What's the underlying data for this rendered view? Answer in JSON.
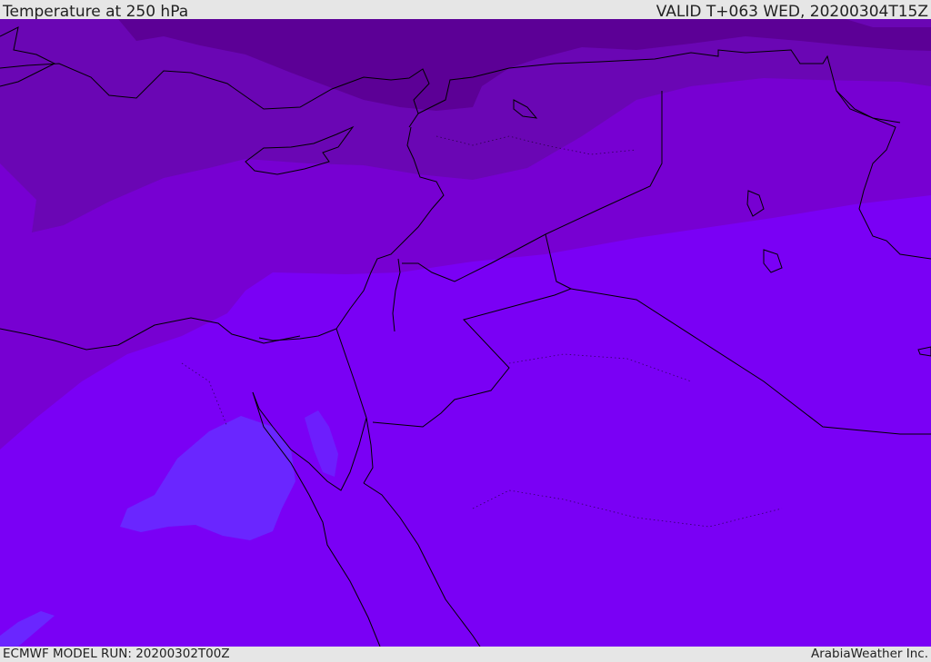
{
  "header": {
    "title": "Temperature at 250 hPa",
    "valid": "VALID T+063 WED, 20200304T15Z"
  },
  "footer": {
    "model_run": "ECMWF MODEL RUN: 20200302T00Z",
    "credit": "ArabiaWeather Inc."
  },
  "map": {
    "region": "Eastern Mediterranean / Levant / Northern Arabia",
    "field": "temperature",
    "colors": {
      "darkest": "#5c0096",
      "dark": "#6a06b4",
      "medium": "#7700d2",
      "light": "#7a00f5",
      "lightest": "#6a26ff",
      "coastline": "#000000"
    }
  }
}
